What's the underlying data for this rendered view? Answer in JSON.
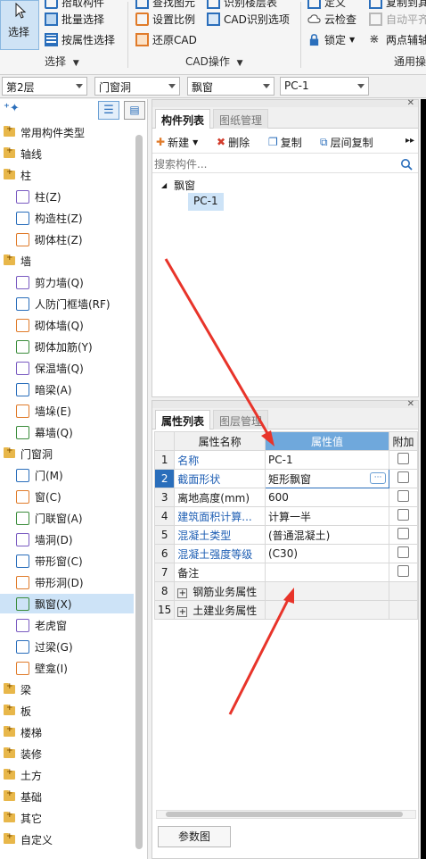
{
  "ribbon": {
    "select_big": "选择",
    "pick_component": "拾取构件",
    "batch_select": "批量选择",
    "select_by_attr": "按属性选择",
    "group_select": "选择",
    "find_element": "查找图元",
    "set_scale": "设置比例",
    "restore_cad": "还原CAD",
    "identify_floor_table": "识别楼层表",
    "cad_options": "CAD识别选项",
    "group_cad": "CAD操作",
    "define": "定义",
    "cloud_check": "云检查",
    "lock": "锁定",
    "copy_to_other": "复制到其它",
    "auto_level": "自动平齐",
    "two_point_axis": "两点辅轴",
    "group_general": "通用操"
  },
  "filters": {
    "floor": "第2层",
    "category": "门窗洞",
    "type": "飘窗",
    "component": "PC-1"
  },
  "tree": {
    "items": [
      {
        "label": "常用构件类型",
        "kind": "folder"
      },
      {
        "label": "轴线",
        "kind": "folder"
      },
      {
        "label": "柱",
        "kind": "folder"
      },
      {
        "label": "柱(Z)",
        "kind": "child"
      },
      {
        "label": "构造柱(Z)",
        "kind": "child"
      },
      {
        "label": "砌体柱(Z)",
        "kind": "child"
      },
      {
        "label": "墙",
        "kind": "folder"
      },
      {
        "label": "剪力墙(Q)",
        "kind": "child"
      },
      {
        "label": "人防门框墙(RF)",
        "kind": "child"
      },
      {
        "label": "砌体墙(Q)",
        "kind": "child"
      },
      {
        "label": "砌体加筋(Y)",
        "kind": "child"
      },
      {
        "label": "保温墙(Q)",
        "kind": "child"
      },
      {
        "label": "暗梁(A)",
        "kind": "child"
      },
      {
        "label": "墙垛(E)",
        "kind": "child"
      },
      {
        "label": "幕墙(Q)",
        "kind": "child"
      },
      {
        "label": "门窗洞",
        "kind": "folder"
      },
      {
        "label": "门(M)",
        "kind": "child"
      },
      {
        "label": "窗(C)",
        "kind": "child"
      },
      {
        "label": "门联窗(A)",
        "kind": "child"
      },
      {
        "label": "墙洞(D)",
        "kind": "child"
      },
      {
        "label": "带形窗(C)",
        "kind": "child"
      },
      {
        "label": "带形洞(D)",
        "kind": "child"
      },
      {
        "label": "飘窗(X)",
        "kind": "child"
      },
      {
        "label": "老虎窗",
        "kind": "child"
      },
      {
        "label": "过梁(G)",
        "kind": "child"
      },
      {
        "label": "壁龛(I)",
        "kind": "child"
      },
      {
        "label": "梁",
        "kind": "folder"
      },
      {
        "label": "板",
        "kind": "folder"
      },
      {
        "label": "楼梯",
        "kind": "folder"
      },
      {
        "label": "装修",
        "kind": "folder"
      },
      {
        "label": "土方",
        "kind": "folder"
      },
      {
        "label": "基础",
        "kind": "folder"
      },
      {
        "label": "其它",
        "kind": "folder"
      },
      {
        "label": "自定义",
        "kind": "folder"
      }
    ]
  },
  "component_panel": {
    "tab_active": "构件列表",
    "tab_inactive": "图纸管理",
    "new": "新建",
    "delete": "删除",
    "copy": "复制",
    "floor_copy": "层间复制",
    "search_placeholder": "搜索构件...",
    "group": "飘窗",
    "item": "PC-1"
  },
  "property_panel": {
    "tab_active": "属性列表",
    "tab_inactive": "图层管理",
    "col_name": "属性名称",
    "col_value": "属性值",
    "col_extra": "附加",
    "rows": [
      {
        "num": "1",
        "name": "名称",
        "value": "PC-1"
      },
      {
        "num": "2",
        "name": "截面形状",
        "value": "矩形飘窗"
      },
      {
        "num": "3",
        "name": "离地高度(mm)",
        "value": "600"
      },
      {
        "num": "4",
        "name": "建筑面积计算...",
        "value": "计算一半"
      },
      {
        "num": "5",
        "name": "混凝土类型",
        "value": "(普通混凝土)"
      },
      {
        "num": "6",
        "name": "混凝土强度等级",
        "value": "(C30)"
      },
      {
        "num": "7",
        "name": "备注",
        "value": ""
      },
      {
        "num": "8",
        "name": "钢筋业务属性",
        "value": ""
      },
      {
        "num": "15",
        "name": "土建业务属性",
        "value": ""
      }
    ],
    "param_button": "参数图"
  },
  "colors": {
    "accent": "#1f5fb4",
    "selection": "#cde3f7",
    "header_value": "#6fa8dc",
    "arrow": "#e8342a"
  }
}
